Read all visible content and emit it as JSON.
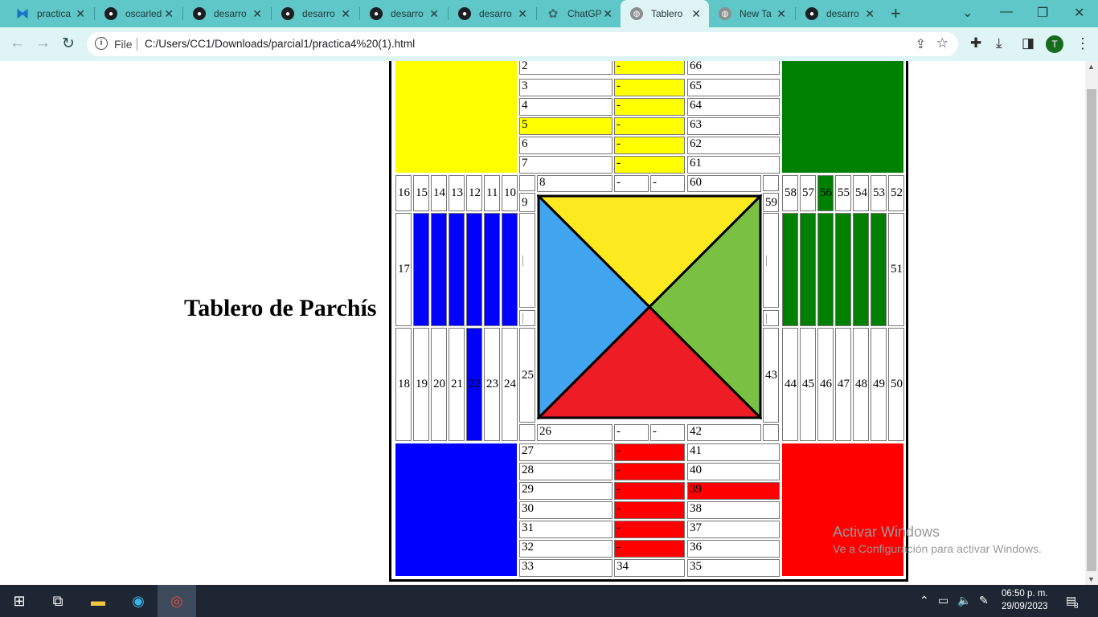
{
  "browser": {
    "tabs": [
      {
        "label": "practica",
        "icon": "vscode-icon"
      },
      {
        "label": "oscarled",
        "icon": "github-icon"
      },
      {
        "label": "desarro",
        "icon": "github-icon"
      },
      {
        "label": "desarro",
        "icon": "github-icon"
      },
      {
        "label": "desarro",
        "icon": "github-icon"
      },
      {
        "label": "desarro",
        "icon": "github-icon"
      },
      {
        "label": "ChatGP",
        "icon": "chatgpt-icon"
      },
      {
        "label": "Tablero",
        "icon": "globe-icon",
        "active": true
      },
      {
        "label": "New Ta",
        "icon": "chrome-icon"
      },
      {
        "label": "desarro",
        "icon": "github-icon"
      }
    ],
    "address": {
      "scheme_label": "File",
      "url": "C:/Users/CC1/Downloads/parcial1/practica4%20(1).html"
    },
    "profile_initial": "T"
  },
  "page": {
    "title": "Tablero de Parchís",
    "colors": {
      "yellow": "#ffff00",
      "green": "#008000",
      "blue": "#0000ff",
      "red": "#ff0000",
      "center_yellow": "#fbea20",
      "center_green": "#7ac143",
      "center_blue": "#40a4ef",
      "center_red": "#ee1c25"
    },
    "top_left_col": [
      "2",
      "3",
      "4",
      "5",
      "6",
      "7"
    ],
    "top_mid_col": [
      "-",
      "-",
      "-",
      "-",
      "-",
      "-"
    ],
    "top_right_col": [
      "66",
      "65",
      "64",
      "63",
      "62",
      "61"
    ],
    "left_top_row": [
      "16",
      "15",
      "14",
      "13",
      "12",
      "11",
      "10"
    ],
    "right_top_row": [
      "58",
      "57",
      "56",
      "55",
      "54",
      "53",
      "52"
    ],
    "left_bottom_row": [
      "18",
      "19",
      "20",
      "21",
      "22",
      "23",
      "24"
    ],
    "right_bottom_row": [
      "44",
      "45",
      "46",
      "47",
      "48",
      "49",
      "50"
    ],
    "left_mid": "17",
    "right_mid": "51",
    "top_track": {
      "a": "8",
      "b": "-",
      "c": "-",
      "d": "60"
    },
    "bottom_track": {
      "a": "26",
      "b": "-",
      "c": "-",
      "d": "42"
    },
    "corners": {
      "tl": "9",
      "tr": "59",
      "bl": "25",
      "br": "43"
    },
    "mark": "|",
    "bottom_left_col": [
      "27",
      "28",
      "29",
      "30",
      "31",
      "32",
      "33"
    ],
    "bottom_mid_col": [
      "-",
      "-",
      "-",
      "-",
      "-",
      "-",
      "34"
    ],
    "bottom_right_col": [
      "41",
      "40",
      "39",
      "38",
      "37",
      "36",
      "35"
    ]
  },
  "watermark": {
    "line1": "Activar Windows",
    "line2": "Ve a Configuración para activar Windows."
  },
  "taskbar": {
    "time": "06:50 p. m.",
    "date": "29/09/2023",
    "notifications": "8"
  }
}
